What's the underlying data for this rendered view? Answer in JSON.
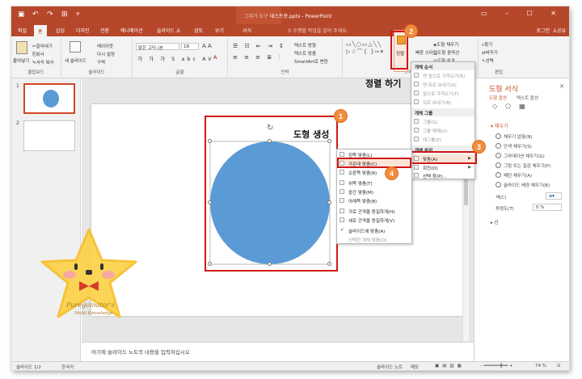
{
  "titlebar": {
    "context_title": "그리기 도구",
    "doc_title": "테스트용.pptx - PowerPoint"
  },
  "tabs": [
    "파일",
    "홈",
    "삽입",
    "디자인",
    "전환",
    "애니메이션",
    "슬라이드 쇼",
    "검토",
    "보기"
  ],
  "context_tab": "서식",
  "tell_me": "수행할 작업을 알려 주세요.",
  "account": {
    "login": "로그인",
    "share": "공유"
  },
  "ribbon": {
    "clipboard": {
      "label": "클립보드",
      "paste": "붙여넣기",
      "cut": "잘라내기",
      "copy": "복사",
      "format_painter": "서식 복사"
    },
    "slides": {
      "label": "슬라이드",
      "new_slide": "새 슬라이드",
      "layout": "레이아웃",
      "reset": "다시 설정",
      "section": "구역"
    },
    "font": {
      "label": "글꼴",
      "font_name": "맑은 고딕 (본",
      "font_size": "18"
    },
    "paragraph": {
      "label": "단락",
      "text_dir": "텍스트 방향",
      "align_text": "텍스트 맞춤",
      "smartart": "SmartArt로 변환"
    },
    "drawing": {
      "label": "그리기",
      "arrange": "정렬",
      "quick_styles": "빠른 스타일",
      "shape_fill": "도형 채우기",
      "shape_outline": "도형 윤곽선",
      "shape_effects": "도형 효과"
    },
    "editing": {
      "label": "편집",
      "find": "찾기",
      "replace": "바꾸기",
      "select": "선택"
    }
  },
  "slides_pane": {
    "slide1_num": "1",
    "slide2_num": "2"
  },
  "notes_placeholder": "여기에 슬라이드 노트의 내용을 입력하십시오",
  "status": {
    "slide_count": "슬라이드 1/2",
    "language": "한국어",
    "notes": "슬라이드 노트",
    "comments": "메모",
    "zoom": "74 %"
  },
  "format_pane": {
    "title": "도형 서식",
    "tab_shape": "도형 옵션",
    "tab_text": "텍스트 옵션",
    "fill_section": "채우기",
    "fill_options": [
      "채우기 없음(N)",
      "단색 채우기(S)",
      "그라데이션 채우기(G)",
      "그림 또는 질감 채우기(P)",
      "패턴 채우기(A)",
      "슬라이드 배경 채우기(B)"
    ],
    "color_label": "색(C)",
    "transparency_label": "투명도(T)",
    "transparency_value": "0 %",
    "line_section": "선"
  },
  "arrange_menu": {
    "header_order": "개체 순서",
    "order_items": [
      "맨 앞으로 가져오기(R)",
      "맨 뒤로 보내기(K)",
      "앞으로 가져오기(F)",
      "뒤로 보내기(B)"
    ],
    "header_group": "개체 그룹",
    "group_items": [
      "그룹(G)",
      "그룹 해제(U)",
      "재그룹(E)"
    ],
    "header_position": "개체 위치",
    "position_items": [
      "맞춤(A)",
      "회전(O)",
      "선택 창(P)..."
    ]
  },
  "align_menu": {
    "items": [
      "왼쪽 맞춤(L)",
      "가운데 맞춤(C)",
      "오른쪽 맞춤(R)",
      "위쪽 맞춤(T)",
      "중간 맞춤(M)",
      "아래쪽 맞춤(B)",
      "가로 간격을 동일하게(H)",
      "세로 간격을 동일하게(V)",
      "슬라이드에 맞춤(A)",
      "선택한 개체 맞춤(O)"
    ]
  },
  "annotations": {
    "c1": "1",
    "c2": "2",
    "c3": "3",
    "c4": "4",
    "shape_create": "도형 생성",
    "arrange_hint": "정렬 하기"
  },
  "watermark": {
    "line1": "Puregoinator's",
    "line2": "Multi Knowledge"
  },
  "colors": {
    "accent": "#b7472a",
    "shape_fill": "#5b9bd5",
    "callout": "#f08c3c",
    "highlight_box": "#d01818",
    "star": "#fcd34d"
  }
}
